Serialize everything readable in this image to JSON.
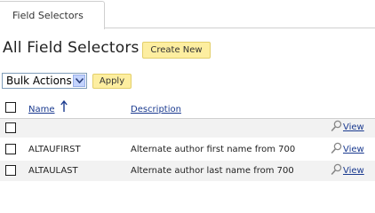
{
  "tabs": [
    {
      "label": "Field Selectors",
      "active": true
    }
  ],
  "page": {
    "title": "All Field Selectors",
    "create_button": "Create New"
  },
  "bulk": {
    "selected": "Bulk Actions",
    "apply_label": "Apply"
  },
  "table": {
    "columns": [
      {
        "label": "Name",
        "sorted": "ascending"
      },
      {
        "label": "Description"
      }
    ],
    "view_label": "View",
    "rows": [
      {
        "name": "ALTAUFIRST",
        "description": "Alternate author first name from 700"
      },
      {
        "name": "ALTAULAST",
        "description": "Alternate author last name from 700"
      }
    ]
  },
  "icons": {
    "sort": "arrow-up-icon",
    "view": "magnifier-icon",
    "dropdown": "chevron-down-icon"
  },
  "colors": {
    "button_bg": "#fdeea0",
    "link": "#1a3a8f",
    "alt_row": "#f2f2f2"
  }
}
